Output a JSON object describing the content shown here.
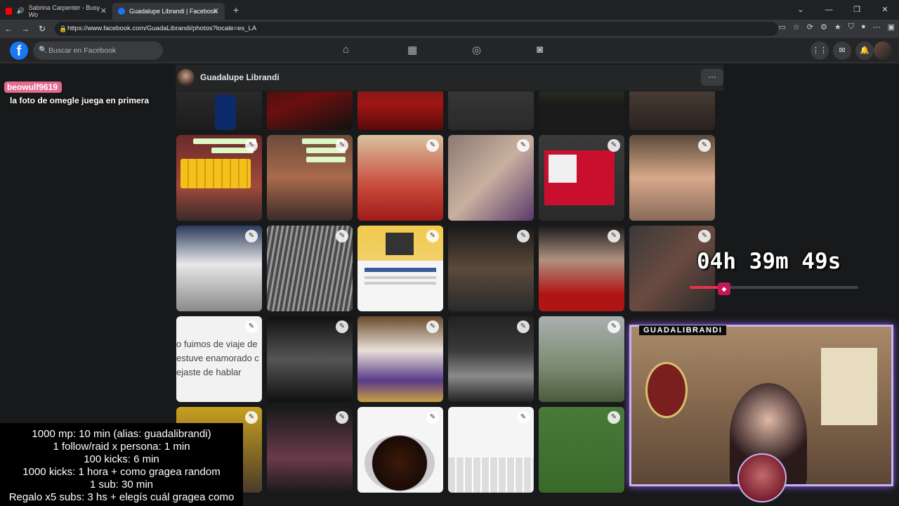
{
  "browser": {
    "tabs": [
      {
        "title": "Sabrina Carpenter - Busy Wo"
      },
      {
        "title": "Guadalupe Librandi | Facebook"
      }
    ],
    "new_tab": "+",
    "url": "https://www.facebook.com/GuadaLibrandi/photos?locale=es_LA"
  },
  "facebook": {
    "logo": "f",
    "search_placeholder": "Buscar en Facebook",
    "profile_name": "Guadalupe Librandi",
    "more_label": "···",
    "photo_text": [
      "o fuimos de viaje de",
      "estuve enamorado c",
      "ejaste de hablar"
    ]
  },
  "overlay": {
    "chat_user": "beowulf9619",
    "chat_message": "la foto de omegle juega en primera",
    "timer": "04h 39m 49s",
    "timer_progress": 0.18,
    "rules": [
      "1000 mp: 10 min (alias: guadalibrandi)",
      "1 follow/raid x persona: 1 min",
      "100 kicks: 6 min",
      "1000 kicks: 1 hora + como gragea random",
      "1 sub: 30 min",
      "Regalo x5 subs: 3 hs + elegís cuál gragea como"
    ],
    "cam_label": "GUADALIBRANDI"
  },
  "icons": [
    "youtube-icon",
    "speaker-icon",
    "facebook-icon",
    "home-icon",
    "marketplace-icon",
    "groups-icon",
    "gaming-icon",
    "menu-grid-icon",
    "messenger-icon",
    "bell-icon",
    "edit-pencil-icon"
  ],
  "colors": {
    "facebook_blue": "#1877f2",
    "chat_pink": "#e46a8f",
    "cam_border": "#c7b3f0"
  }
}
